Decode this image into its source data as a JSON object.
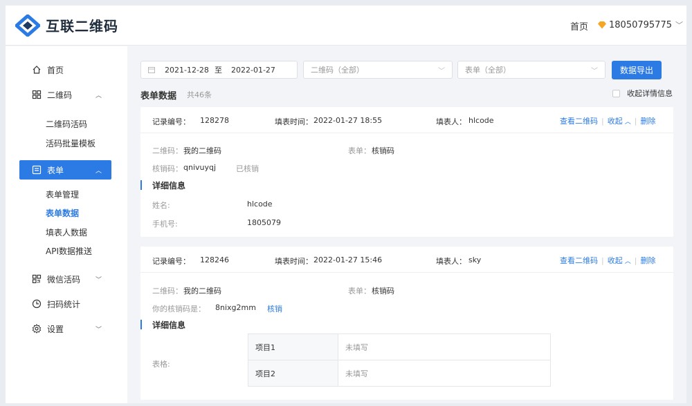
{
  "header": {
    "brand": "互联二维码",
    "home": "首页",
    "user": "18050795775"
  },
  "sidebar": {
    "items": [
      {
        "label": "首页",
        "icon": "home-icon"
      },
      {
        "label": "二维码",
        "icon": "qrcode-icon",
        "arrow": "up-chevron"
      },
      {
        "label": "表单",
        "icon": "form-icon",
        "arrow": "up-chevron",
        "active": true
      },
      {
        "label": "微信活码",
        "icon": "wechat-qr-icon",
        "arrow": "down-chevron"
      },
      {
        "label": "扫码统计",
        "icon": "clock-icon"
      },
      {
        "label": "设置",
        "icon": "gear-icon",
        "arrow": "down-chevron"
      }
    ],
    "qrcode_sub": [
      "二维码活码",
      "活码批量模板"
    ],
    "form_sub": [
      "表单管理",
      "表单数据",
      "填表人数据",
      "API数据推送"
    ]
  },
  "filters": {
    "date_start": "2021-12-28",
    "date_to": "至",
    "date_end": "2022-01-27",
    "qrcode_select": "二维码（全部）",
    "form_select": "表单（全部）",
    "export": "数据导出"
  },
  "list": {
    "title": "表单数据",
    "count": "共46条",
    "collapse_all": "收起详情信息"
  },
  "records": [
    {
      "id_label": "记录编号：",
      "id": "128278",
      "time_label": "填表时间：",
      "time": "2022-01-27 18:55",
      "filler_label": "填表人：",
      "filler": "hlcode",
      "view_qr": "查看二维码",
      "collapse": "收起",
      "delete": "删除",
      "qr_label": "二维码：",
      "qr": "我的二维码",
      "form_label": "表单：",
      "form": "核销码",
      "code_label": "核销码：",
      "code": "qnivuyqj",
      "code_status": "已核销",
      "detail_title": "详细信息",
      "fields": [
        {
          "label": "姓名:",
          "value": "hlcode"
        },
        {
          "label": "手机号:",
          "value": "1805079"
        }
      ]
    },
    {
      "id_label": "记录编号：",
      "id": "128246",
      "time_label": "填表时间：",
      "time": "2022-01-27 15:46",
      "filler_label": "填表人：",
      "filler": "sky",
      "view_qr": "查看二维码",
      "collapse": "收起",
      "delete": "删除",
      "qr_label": "二维码：",
      "qr": "我的二维码",
      "form_label": "表单：",
      "form": "核销码",
      "code_label": "你的核销码是：",
      "code": "8nixg2mm",
      "code_action": "核销",
      "detail_title": "详细信息",
      "table_label": "表格:",
      "table": [
        {
          "item": "项目1",
          "value": "未填写"
        },
        {
          "item": "项目2",
          "value": "未填写"
        }
      ]
    }
  ],
  "colors": {
    "accent": "#2c7be5",
    "gem": "#f5a623"
  }
}
